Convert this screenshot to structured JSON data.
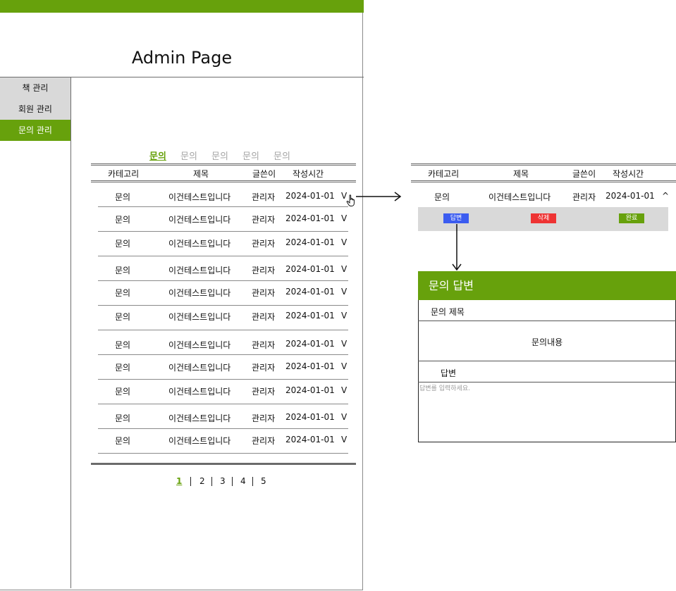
{
  "header": {
    "title": "Admin Page"
  },
  "sidebar": {
    "items": [
      {
        "label": "책 관리"
      },
      {
        "label": "회원 관리"
      },
      {
        "label": "문의 관리"
      }
    ]
  },
  "tabs": [
    {
      "label": "문의"
    },
    {
      "label": "문의"
    },
    {
      "label": "문의"
    },
    {
      "label": "문의"
    },
    {
      "label": "문의"
    }
  ],
  "table": {
    "headers": [
      "카테고리",
      "제목",
      "글쓴이",
      "작성시간"
    ],
    "rows": [
      {
        "category": "문의",
        "title": "이건테스트입니다",
        "author": "관리자",
        "date": "2024-01-01",
        "toggle": "V"
      },
      {
        "category": "문의",
        "title": "이건테스트입니다",
        "author": "관리자",
        "date": "2024-01-01",
        "toggle": "V"
      },
      {
        "category": "문의",
        "title": "이건테스트입니다",
        "author": "관리자",
        "date": "2024-01-01",
        "toggle": "V"
      },
      {
        "category": "문의",
        "title": "이건테스트입니다",
        "author": "관리자",
        "date": "2024-01-01",
        "toggle": "V"
      },
      {
        "category": "문의",
        "title": "이건테스트입니다",
        "author": "관리자",
        "date": "2024-01-01",
        "toggle": "V"
      },
      {
        "category": "문의",
        "title": "이건테스트입니다",
        "author": "관리자",
        "date": "2024-01-01",
        "toggle": "V"
      },
      {
        "category": "문의",
        "title": "이건테스트입니다",
        "author": "관리자",
        "date": "2024-01-01",
        "toggle": "V"
      },
      {
        "category": "문의",
        "title": "이건테스트입니다",
        "author": "관리자",
        "date": "2024-01-01",
        "toggle": "V"
      },
      {
        "category": "문의",
        "title": "이건테스트입니다",
        "author": "관리자",
        "date": "2024-01-01",
        "toggle": "V"
      },
      {
        "category": "문의",
        "title": "이건테스트입니다",
        "author": "관리자",
        "date": "2024-01-01",
        "toggle": "V"
      },
      {
        "category": "문의",
        "title": "이건테스트입니다",
        "author": "관리자",
        "date": "2024-01-01",
        "toggle": "V"
      }
    ]
  },
  "pagination": {
    "pages": [
      "1",
      "2",
      "3",
      "4",
      "5"
    ],
    "current": "1"
  },
  "expanded": {
    "headers": [
      "카테고리",
      "제목",
      "글쓴이",
      "작성시간"
    ],
    "row": {
      "category": "문의",
      "title": "이건테스트입니다",
      "author": "관리자",
      "date": "2024-01-01",
      "toggle": "^"
    },
    "buttons": {
      "answer": "답변",
      "delete": "삭제",
      "complete": "완료"
    }
  },
  "answer_modal": {
    "title": "문의 답변",
    "subject_label": "문의 제목",
    "content": "문의내용",
    "answer_label": "답변",
    "answer_placeholder": "답변를 입력하세요."
  },
  "colors": {
    "accent": "#67a10c",
    "answer_button": "#3b5cf0",
    "delete_button": "#ee3333",
    "complete_button": "#67a10c",
    "sidebar_bg": "#d9d9d9"
  },
  "icons": {
    "cursor": "hand-pointer-icon",
    "arrows": "arrow-icon"
  }
}
